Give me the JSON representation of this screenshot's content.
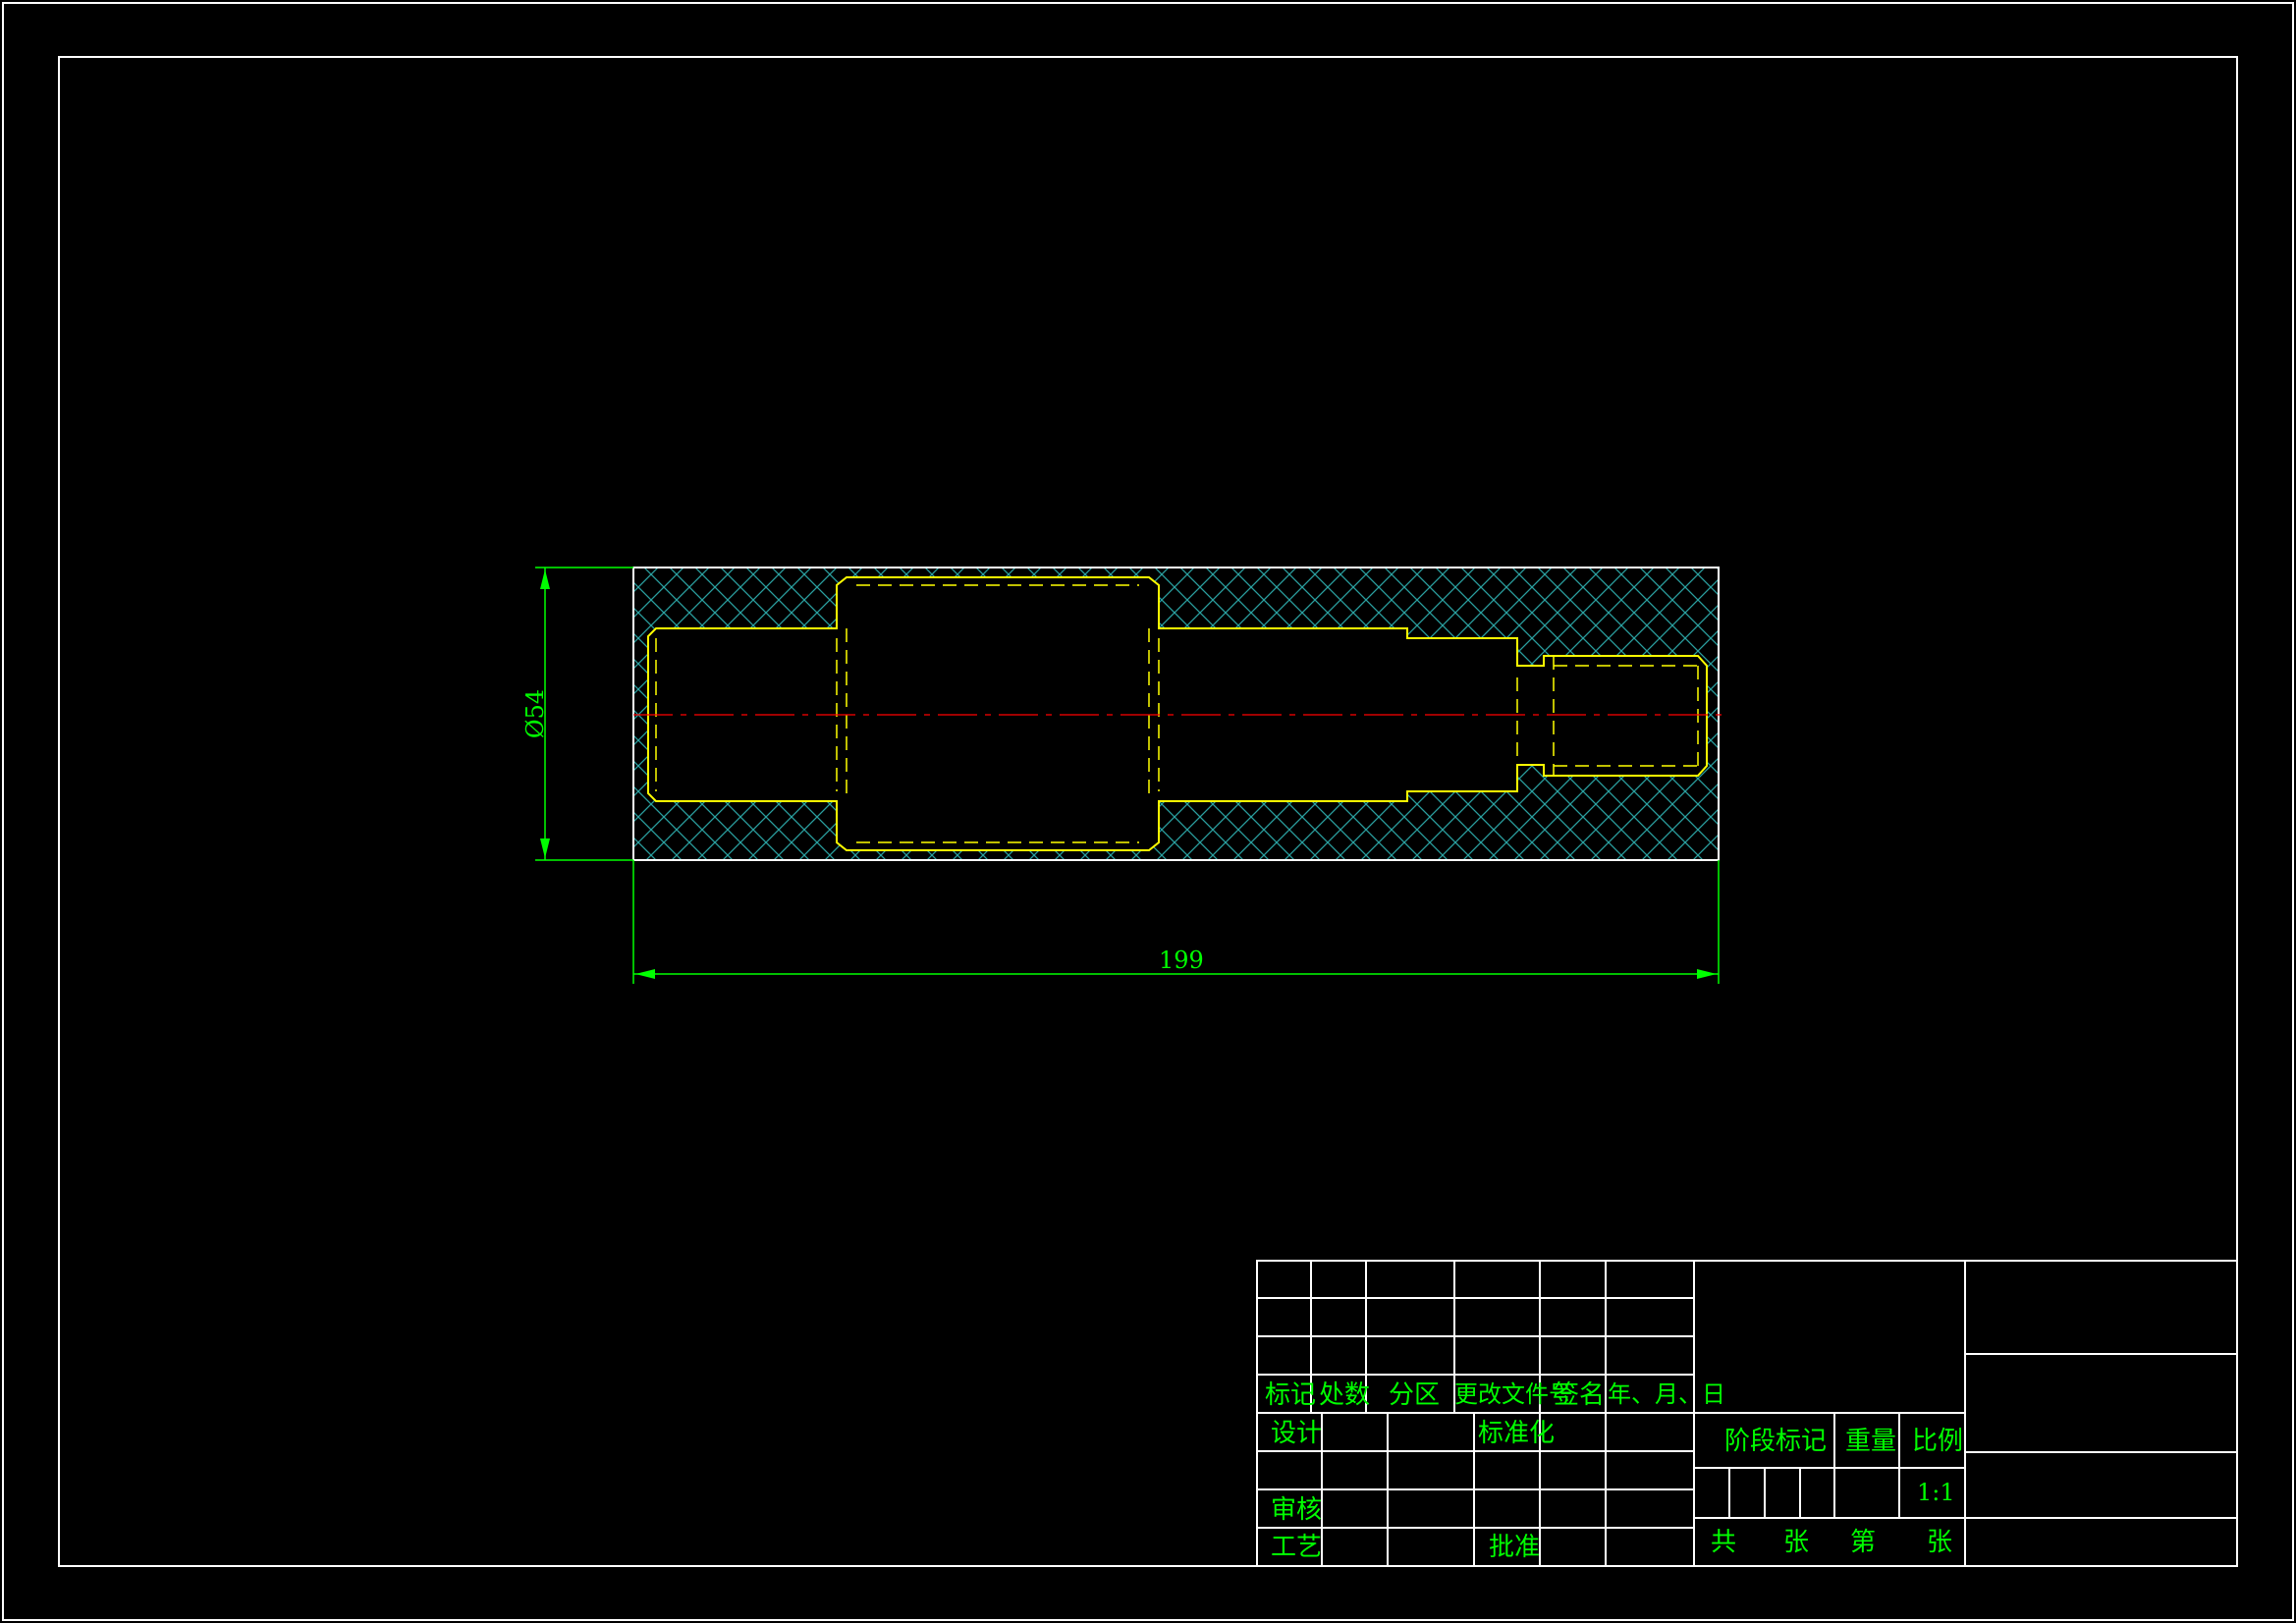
{
  "colors": {
    "background": "#000000",
    "frame": "#ffffff",
    "hatch": "#2aa0a0",
    "part_outline": "#ffff00",
    "centerline": "#ff0000",
    "dimension": "#00ff00"
  },
  "drawing": {
    "dimensions": {
      "diameter": "Ø54",
      "length": "199"
    }
  },
  "title_block": {
    "mark": "标记",
    "count": "处数",
    "zone": "分区",
    "change_doc": "更改文件号",
    "signature": "签名",
    "date": "年、月、日",
    "design": "设计",
    "standardization": "标准化",
    "review": "审核",
    "process": "工艺",
    "approve": "批准",
    "stage_mark": "阶段标记",
    "weight": "重量",
    "scale": "比例",
    "scale_value": "1:1",
    "total": "共",
    "sheets": "张",
    "number": "第",
    "sheet": "张"
  }
}
